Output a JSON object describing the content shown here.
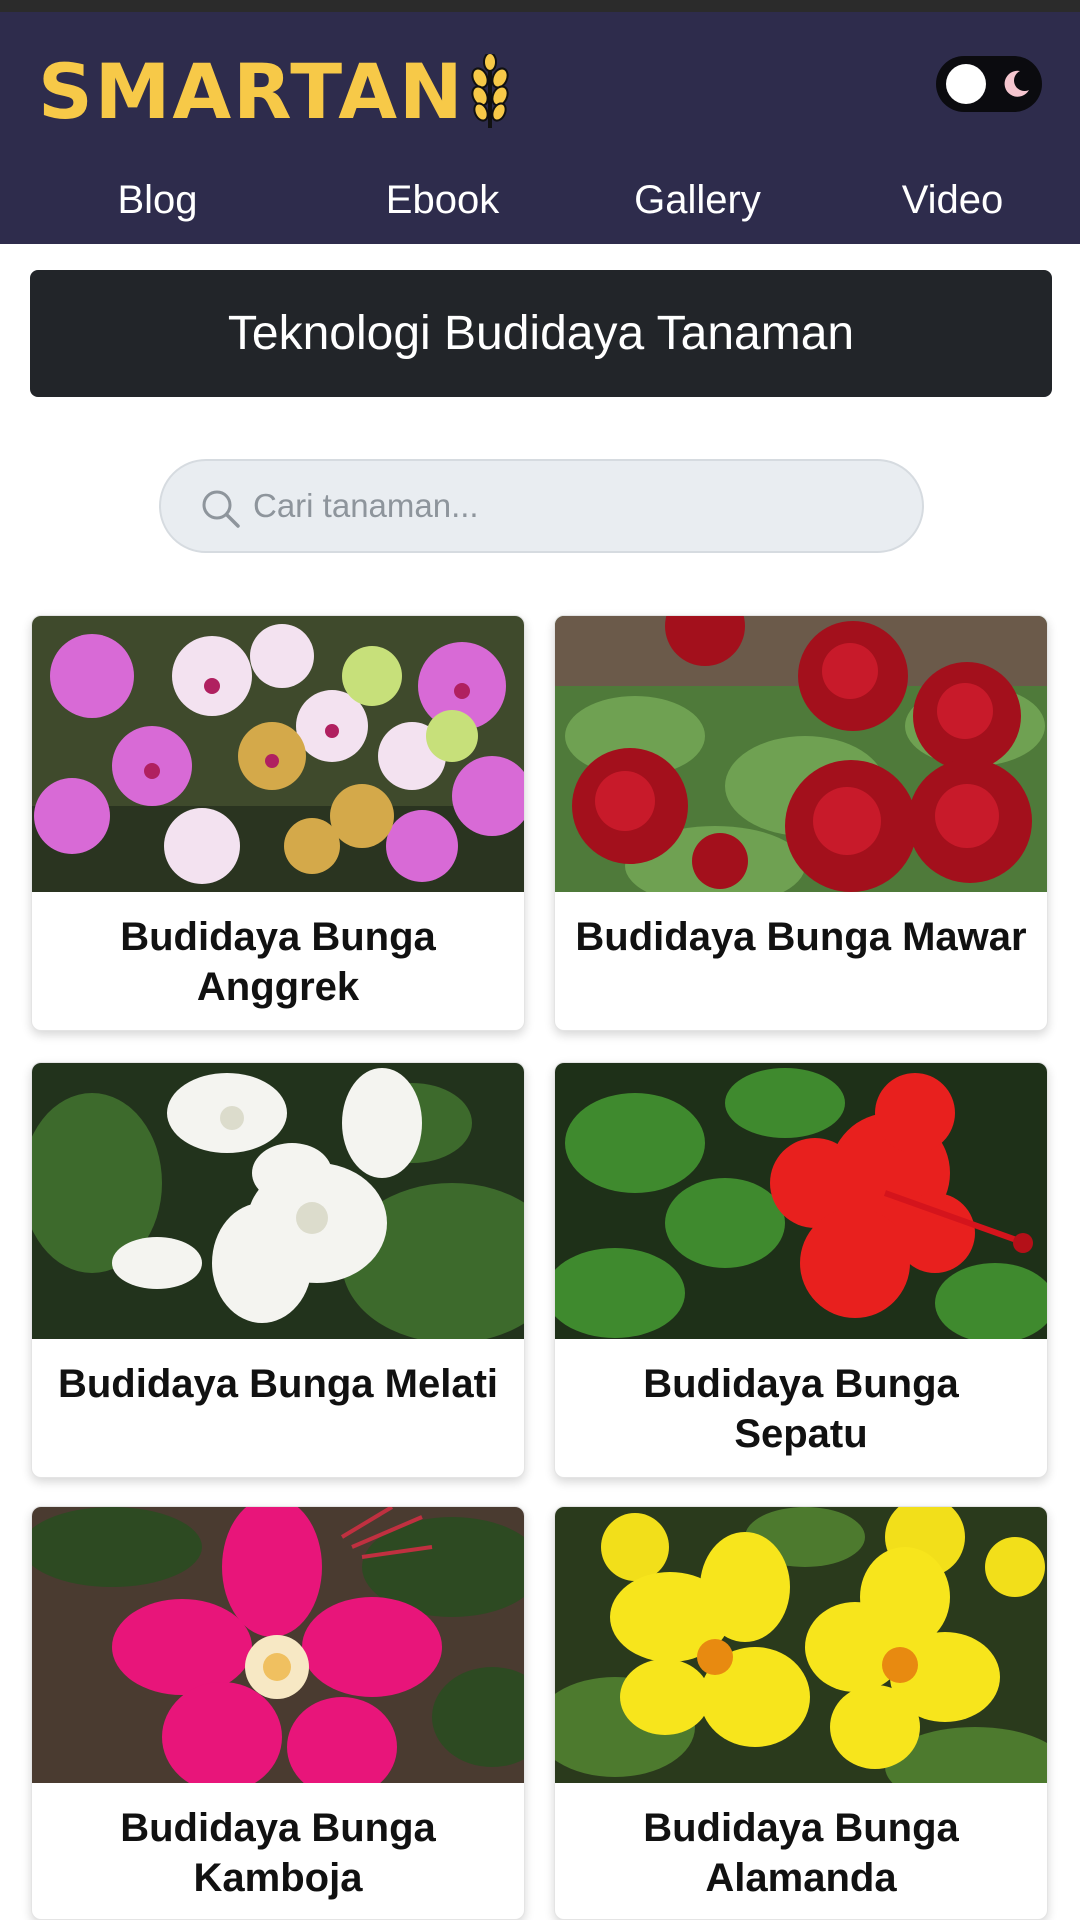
{
  "header": {
    "logo_text": "SMARTAN",
    "colors": {
      "background": "#2e2c4c",
      "logo": "#f7c948",
      "title_bar": "#222529"
    },
    "nav": [
      {
        "label": "Blog"
      },
      {
        "label": "Ebook"
      },
      {
        "label": "Gallery"
      },
      {
        "label": "Video"
      }
    ]
  },
  "theme_toggle": {
    "state": "light",
    "icon": "moon-icon"
  },
  "page_title": "Teknologi Budidaya Tanaman",
  "search": {
    "placeholder": "Cari tanaman...",
    "value": "",
    "icon": "search-icon"
  },
  "cards": [
    {
      "title": "Budidaya Bunga Anggrek",
      "image": "orchid-photo"
    },
    {
      "title": "Budidaya Bunga Mawar",
      "image": "rose-photo"
    },
    {
      "title": "Budidaya Bunga Melati",
      "image": "jasmine-photo"
    },
    {
      "title": "Budidaya Bunga Sepatu",
      "image": "hibiscus-photo"
    },
    {
      "title": "Budidaya Bunga Kamboja",
      "image": "adenium-photo"
    },
    {
      "title": "Budidaya Bunga Alamanda",
      "image": "allamanda-photo"
    }
  ]
}
